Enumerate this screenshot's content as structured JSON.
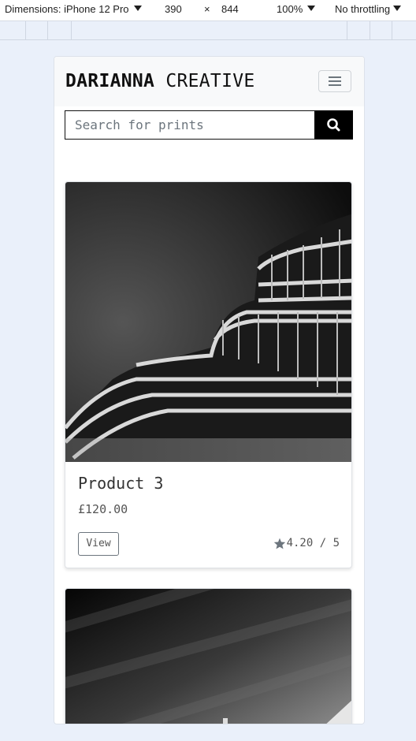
{
  "devtools": {
    "dimensions_label": "Dimensions: iPhone 12 Pro",
    "width": "390",
    "times": "×",
    "height": "844",
    "zoom": "100%",
    "throttling": "No throttling"
  },
  "site": {
    "brand_bold": "DARIANNA",
    "brand_light": "CREATIVE"
  },
  "search": {
    "placeholder": "Search for prints",
    "button_icon": "search-icon"
  },
  "products": [
    {
      "title": "Product 3",
      "price": "£120.00",
      "view_label": "View",
      "rating": "4.20 / 5",
      "image": "black-and-white curved building architecture"
    },
    {
      "image": "black-and-white sky streaks"
    }
  ],
  "colors": {
    "page_bg": "#eaf0fa",
    "navbar_bg": "#f8f9fa",
    "search_button": "#000000"
  }
}
